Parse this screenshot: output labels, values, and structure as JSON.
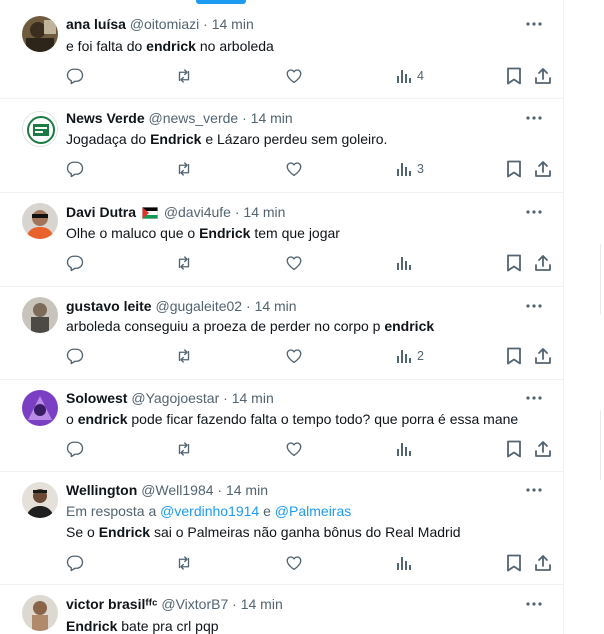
{
  "posts": [
    {
      "name": "ana luísa",
      "handle": "@oitomiazi",
      "dot": "·",
      "time": "14 min",
      "text_parts": [
        "e foi falta do ",
        "endrick",
        " no arboleda"
      ],
      "views": "4"
    },
    {
      "name": "News Verde",
      "handle": "@news_verde",
      "dot": "·",
      "time": "14 min",
      "text_parts": [
        "Jogadaça do ",
        "Endrick",
        " e Lázaro perdeu sem goleiro."
      ],
      "views": "3"
    },
    {
      "name": "Davi Dutra",
      "flag": "palestine-flag",
      "handle": "@davi4ufe",
      "dot": "·",
      "time": "14 min",
      "text_parts": [
        "Olhe o maluco que o ",
        "Endrick",
        " tem que jogar"
      ],
      "views": ""
    },
    {
      "name": "gustavo leite",
      "handle": "@gugaleite02",
      "dot": "·",
      "time": "14 min",
      "text_parts": [
        "arboleda conseguiu a proeza de perder no corpo p ",
        "endrick",
        ""
      ],
      "views": "2"
    },
    {
      "name": "Solowest",
      "handle": "@Yagojoestar",
      "dot": "·",
      "time": "14 min",
      "text_parts": [
        "o ",
        "endrick",
        " pode ficar fazendo falta o tempo todo? que porra é essa mane"
      ],
      "views": ""
    },
    {
      "name": "Wellington",
      "handle": "@Well1984",
      "dot": "·",
      "time": "14 min",
      "reply_prefix": "Em resposta a ",
      "reply_user1": "@verdinho1914",
      "reply_and": " e ",
      "reply_user2": "@Palmeiras",
      "text_parts": [
        "Se o ",
        "Endrick",
        " sai o Palmeiras não ganha bônus do Real Madrid"
      ],
      "views": ""
    },
    {
      "name": "victor brasil",
      "name_suffix": "ᶠᶠᶜ",
      "handle": "@VixtorB7",
      "dot": "·",
      "time": "14 min",
      "text_parts": [
        "",
        "Endrick",
        " bate pra crl pqp"
      ]
    }
  ],
  "icons": {
    "reply": "reply-icon",
    "repost": "repost-icon",
    "like": "like-icon",
    "views": "views-icon",
    "bookmark": "bookmark-icon",
    "share": "share-icon",
    "more": "more-icon"
  },
  "colors": {
    "text": "#0f1419",
    "muted": "#536471",
    "link": "#1d9bf0",
    "border": "#eff3f4"
  }
}
